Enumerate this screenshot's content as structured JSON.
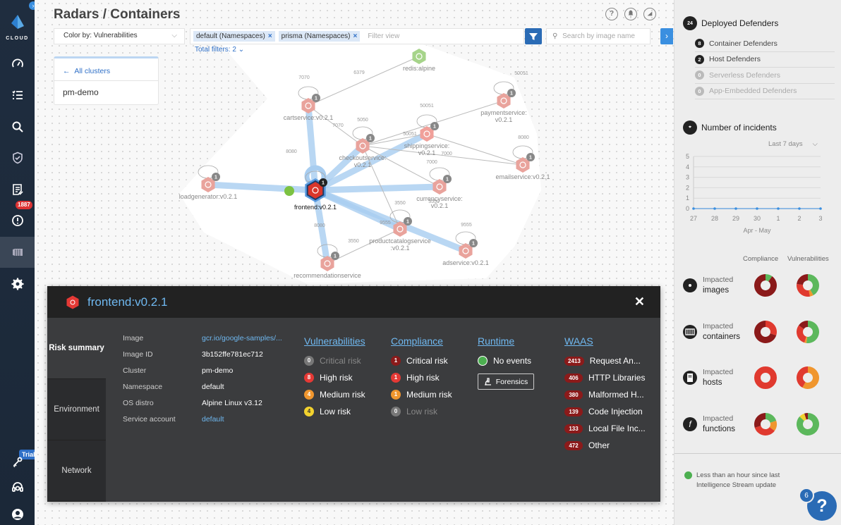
{
  "sidebar": {
    "logo_text": "CLOUD",
    "items": [
      {
        "name": "dashboard",
        "icon": "speedometer-icon"
      },
      {
        "name": "checklist",
        "icon": "checklist-icon"
      },
      {
        "name": "search",
        "icon": "search-icon"
      },
      {
        "name": "defend",
        "icon": "shield-check-icon"
      },
      {
        "name": "compliance",
        "icon": "report-icon"
      },
      {
        "name": "alerts",
        "icon": "alert-circle-icon",
        "badge": "1887"
      },
      {
        "name": "radars",
        "icon": "radar-icon",
        "active": true
      },
      {
        "name": "manage",
        "icon": "gear-icon"
      }
    ],
    "bottom_items": [
      {
        "name": "trial-keys",
        "icon": "keys-icon",
        "badge": "Trial"
      },
      {
        "name": "support",
        "icon": "headset-icon"
      },
      {
        "name": "account",
        "icon": "user-icon"
      }
    ]
  },
  "header": {
    "title": "Radars / Containers",
    "icons": [
      "help-icon",
      "bell-icon",
      "signal-icon"
    ],
    "help_glyph": "?"
  },
  "toolbar": {
    "color_by": "Color by: Vulnerabilities",
    "filter_chips": [
      "default (Namespaces)",
      "prisma (Namespaces)"
    ],
    "filter_placeholder": "Filter view",
    "search_placeholder": "Search by image name",
    "total_filters": "Total filters: 2"
  },
  "cluster_card": {
    "back_label": "All clusters",
    "cluster_name": "pm-demo"
  },
  "graph": {
    "nodes": [
      {
        "id": "redis",
        "label": "redis:alpine",
        "type": "green"
      },
      {
        "id": "cart",
        "label": "cartservice:v0.2.1",
        "badge": "1"
      },
      {
        "id": "payment",
        "label": "paymentservice:",
        "label2": "v0.2.1",
        "badge": "1"
      },
      {
        "id": "checkout",
        "label": "checkoutservice:",
        "label2": "v0.2.1",
        "badge": "1"
      },
      {
        "id": "shipping",
        "label": "shippingservice:",
        "label2": "v0.2.1",
        "badge": "1"
      },
      {
        "id": "email",
        "label": "emailservice:v0.2.1",
        "badge": "1"
      },
      {
        "id": "loadgen",
        "label": "loadgenerator:v0.2.1",
        "badge": "1"
      },
      {
        "id": "frontend",
        "label": "frontend:v0.2.1",
        "badge": "1",
        "selected": true
      },
      {
        "id": "currency",
        "label": "currencyservice:",
        "label2": "v0.2.1",
        "badge": "1"
      },
      {
        "id": "productcatalog",
        "label": "productcatalogservice",
        "label2": ":v0.2.1",
        "badge": "1"
      },
      {
        "id": "ad",
        "label": "adservice:v0.2.1",
        "badge": "1"
      },
      {
        "id": "recommendation",
        "label": "recommendationservice",
        "badge": "1"
      }
    ],
    "port_labels": [
      "7070",
      "6379",
      "5050",
      "50051",
      "50051",
      "8080",
      "8080",
      "8080",
      "7000",
      "7000",
      "3550",
      "3550",
      "9555",
      "8080",
      "7070",
      "50051",
      "3550",
      "9555"
    ]
  },
  "detail": {
    "title": "frontend:v0.2.1",
    "tabs": [
      "Risk summary",
      "Environment",
      "Network"
    ],
    "info": [
      {
        "key": "Image",
        "value": "gcr.io/google-samples/...",
        "link": true
      },
      {
        "key": "Image ID",
        "value": "3b152ffe781ec712"
      },
      {
        "key": "Cluster",
        "value": "pm-demo"
      },
      {
        "key": "Namespace",
        "value": "default"
      },
      {
        "key": "OS distro",
        "value": "Alpine Linux v3.12"
      },
      {
        "key": "Service account",
        "value": "default",
        "link": true
      }
    ],
    "vulnerabilities": {
      "title": "Vulnerabilities",
      "rows": [
        {
          "count": "0",
          "label": "Critical risk",
          "color": "#777777",
          "dim": true
        },
        {
          "count": "8",
          "label": "High risk",
          "color": "#e53935"
        },
        {
          "count": "4",
          "label": "Medium risk",
          "color": "#f0962e"
        },
        {
          "count": "4",
          "label": "Low risk",
          "color": "#f2d22e"
        }
      ]
    },
    "compliance": {
      "title": "Compliance",
      "rows": [
        {
          "count": "1",
          "label": "Critical risk",
          "color": "#8b1a1a"
        },
        {
          "count": "1",
          "label": "High risk",
          "color": "#e53935"
        },
        {
          "count": "1",
          "label": "Medium risk",
          "color": "#f0962e"
        },
        {
          "count": "0",
          "label": "Low risk",
          "color": "#777777",
          "dim": true
        }
      ]
    },
    "runtime": {
      "title": "Runtime",
      "status": "No events",
      "forensics_label": "Forensics"
    },
    "waas": {
      "title": "WAAS",
      "rows": [
        {
          "count": "2413",
          "label": "Request An..."
        },
        {
          "count": "406",
          "label": "HTTP Libraries"
        },
        {
          "count": "380",
          "label": "Malformed H..."
        },
        {
          "count": "139",
          "label": "Code Injection"
        },
        {
          "count": "133",
          "label": "Local File Inc..."
        },
        {
          "count": "472",
          "label": "Other"
        }
      ]
    },
    "close_glyph": "✕"
  },
  "right_panel": {
    "defenders_title": "Deployed Defenders",
    "defenders_icon_text": "24",
    "defenders": [
      {
        "count": "8",
        "label": "Container Defenders"
      },
      {
        "count": "2",
        "label": "Host Defenders"
      },
      {
        "count": "0",
        "label": "Serverless Defenders",
        "dim": true
      },
      {
        "count": "0",
        "label": "App-Embedded Defenders",
        "dim": true
      }
    ],
    "incidents_title": "Number of incidents",
    "range_select": "Last 7 days",
    "compliance_header": "Compliance",
    "vulnerabilities_header": "Vulnerabilities",
    "impacted": [
      {
        "small": "Impacted",
        "big": "images",
        "icon": "image-disc-icon"
      },
      {
        "small": "Impacted",
        "big": "containers",
        "icon": "container-icon"
      },
      {
        "small": "Impacted",
        "big": "hosts",
        "icon": "server-icon"
      },
      {
        "small": "Impacted",
        "big": "functions",
        "icon": "function-icon"
      }
    ],
    "donuts": {
      "colors": {
        "critical": "#8b1a1a",
        "high": "#e03a2f",
        "medium": "#f0962e",
        "low": "#f2d22e",
        "ok": "#5cb85c"
      },
      "images": {
        "compliance": [
          {
            "k": "ok",
            "v": 0.1
          },
          {
            "k": "critical",
            "v": 0.9
          }
        ],
        "vulnerabilities": [
          {
            "k": "ok",
            "v": 0.42
          },
          {
            "k": "medium",
            "v": 0.05
          },
          {
            "k": "high",
            "v": 0.3
          },
          {
            "k": "critical",
            "v": 0.23
          }
        ]
      },
      "containers": {
        "compliance": [
          {
            "k": "high",
            "v": 0.3
          },
          {
            "k": "critical",
            "v": 0.7
          }
        ],
        "vulnerabilities": [
          {
            "k": "ok",
            "v": 0.52
          },
          {
            "k": "medium",
            "v": 0.03
          },
          {
            "k": "high",
            "v": 0.3
          },
          {
            "k": "critical",
            "v": 0.15
          }
        ]
      },
      "hosts": {
        "compliance": [
          {
            "k": "high",
            "v": 1.0
          }
        ],
        "vulnerabilities": [
          {
            "k": "medium",
            "v": 0.58
          },
          {
            "k": "high",
            "v": 0.42
          }
        ]
      },
      "functions": {
        "compliance": [
          {
            "k": "ok",
            "v": 0.2
          },
          {
            "k": "medium",
            "v": 0.15
          },
          {
            "k": "high",
            "v": 0.35
          },
          {
            "k": "critical",
            "v": 0.3
          }
        ],
        "vulnerabilities": [
          {
            "k": "ok",
            "v": 0.87
          },
          {
            "k": "low",
            "v": 0.08
          },
          {
            "k": "critical",
            "v": 0.05
          }
        ]
      }
    },
    "stream_status": "Less than an hour since last Intelligence Stream update",
    "help_count": "6",
    "help_glyph": "?"
  },
  "chart_data": {
    "type": "line",
    "title": "Number of incidents",
    "categories": [
      "27",
      "28",
      "29",
      "30",
      "1",
      "2",
      "3"
    ],
    "series": [
      {
        "name": "Incidents",
        "values": [
          0,
          0,
          0,
          0,
          0,
          0,
          0
        ]
      }
    ],
    "xlabel": "Apr - May",
    "ylabel": "",
    "yticks": [
      "0",
      "1",
      "2",
      "3",
      "4",
      "5"
    ],
    "ylim": [
      0,
      5
    ],
    "grid": true
  }
}
